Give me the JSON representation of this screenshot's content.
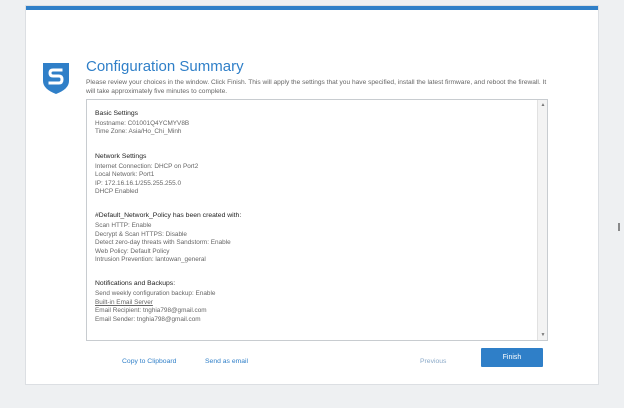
{
  "header": {
    "title": "Configuration Summary",
    "description": "Please review your choices in the window. Click Finish. This will apply the settings that you have specified, install the latest firmware, and reboot the firewall. It will take approximately five minutes to complete."
  },
  "summary": {
    "basic": {
      "title": "Basic Settings",
      "hostname": "Hostname: C01001Q4YCMYV8B",
      "timezone": "Time Zone: Asia/Ho_Chi_Minh"
    },
    "network": {
      "title": "Network Settings",
      "internet": "Internet Connection: DHCP on Port2",
      "local": "Local Network: Port1",
      "ip": "IP: 172.16.16.1/255.255.255.0",
      "dhcp": "DHCP Enabled"
    },
    "policy": {
      "title": "#Default_Network_Policy has been created with:",
      "scan_http": "Scan HTTP: Enable",
      "decrypt": "Decrypt & Scan HTTPS: Disable",
      "zero_day": "Detect zero-day threats with Sandstorm: Enable",
      "web_policy": "Web Policy: Default Policy",
      "ips": "Intrusion Prevention: lantowan_general"
    },
    "notifications": {
      "title": "Notifications and Backups:",
      "backup": "Send weekly configuration backup: Enable",
      "email_server": "Built-in Email Server",
      "recipient": "Email Recipient: tnghia798@gmail.com",
      "sender": "Email Sender: tnghia798@gmail.com"
    }
  },
  "footer": {
    "copy_label": "Copy to Clipboard",
    "email_label": "Send as email",
    "previous_label": "Previous",
    "finish_label": "Finish"
  },
  "colors": {
    "accent": "#2f7fc8",
    "logo": "#2f7fc8"
  },
  "icons": {
    "logo": "sophos-shield-icon",
    "scroll_up": "arrow-up-icon",
    "scroll_down": "arrow-down-icon"
  }
}
